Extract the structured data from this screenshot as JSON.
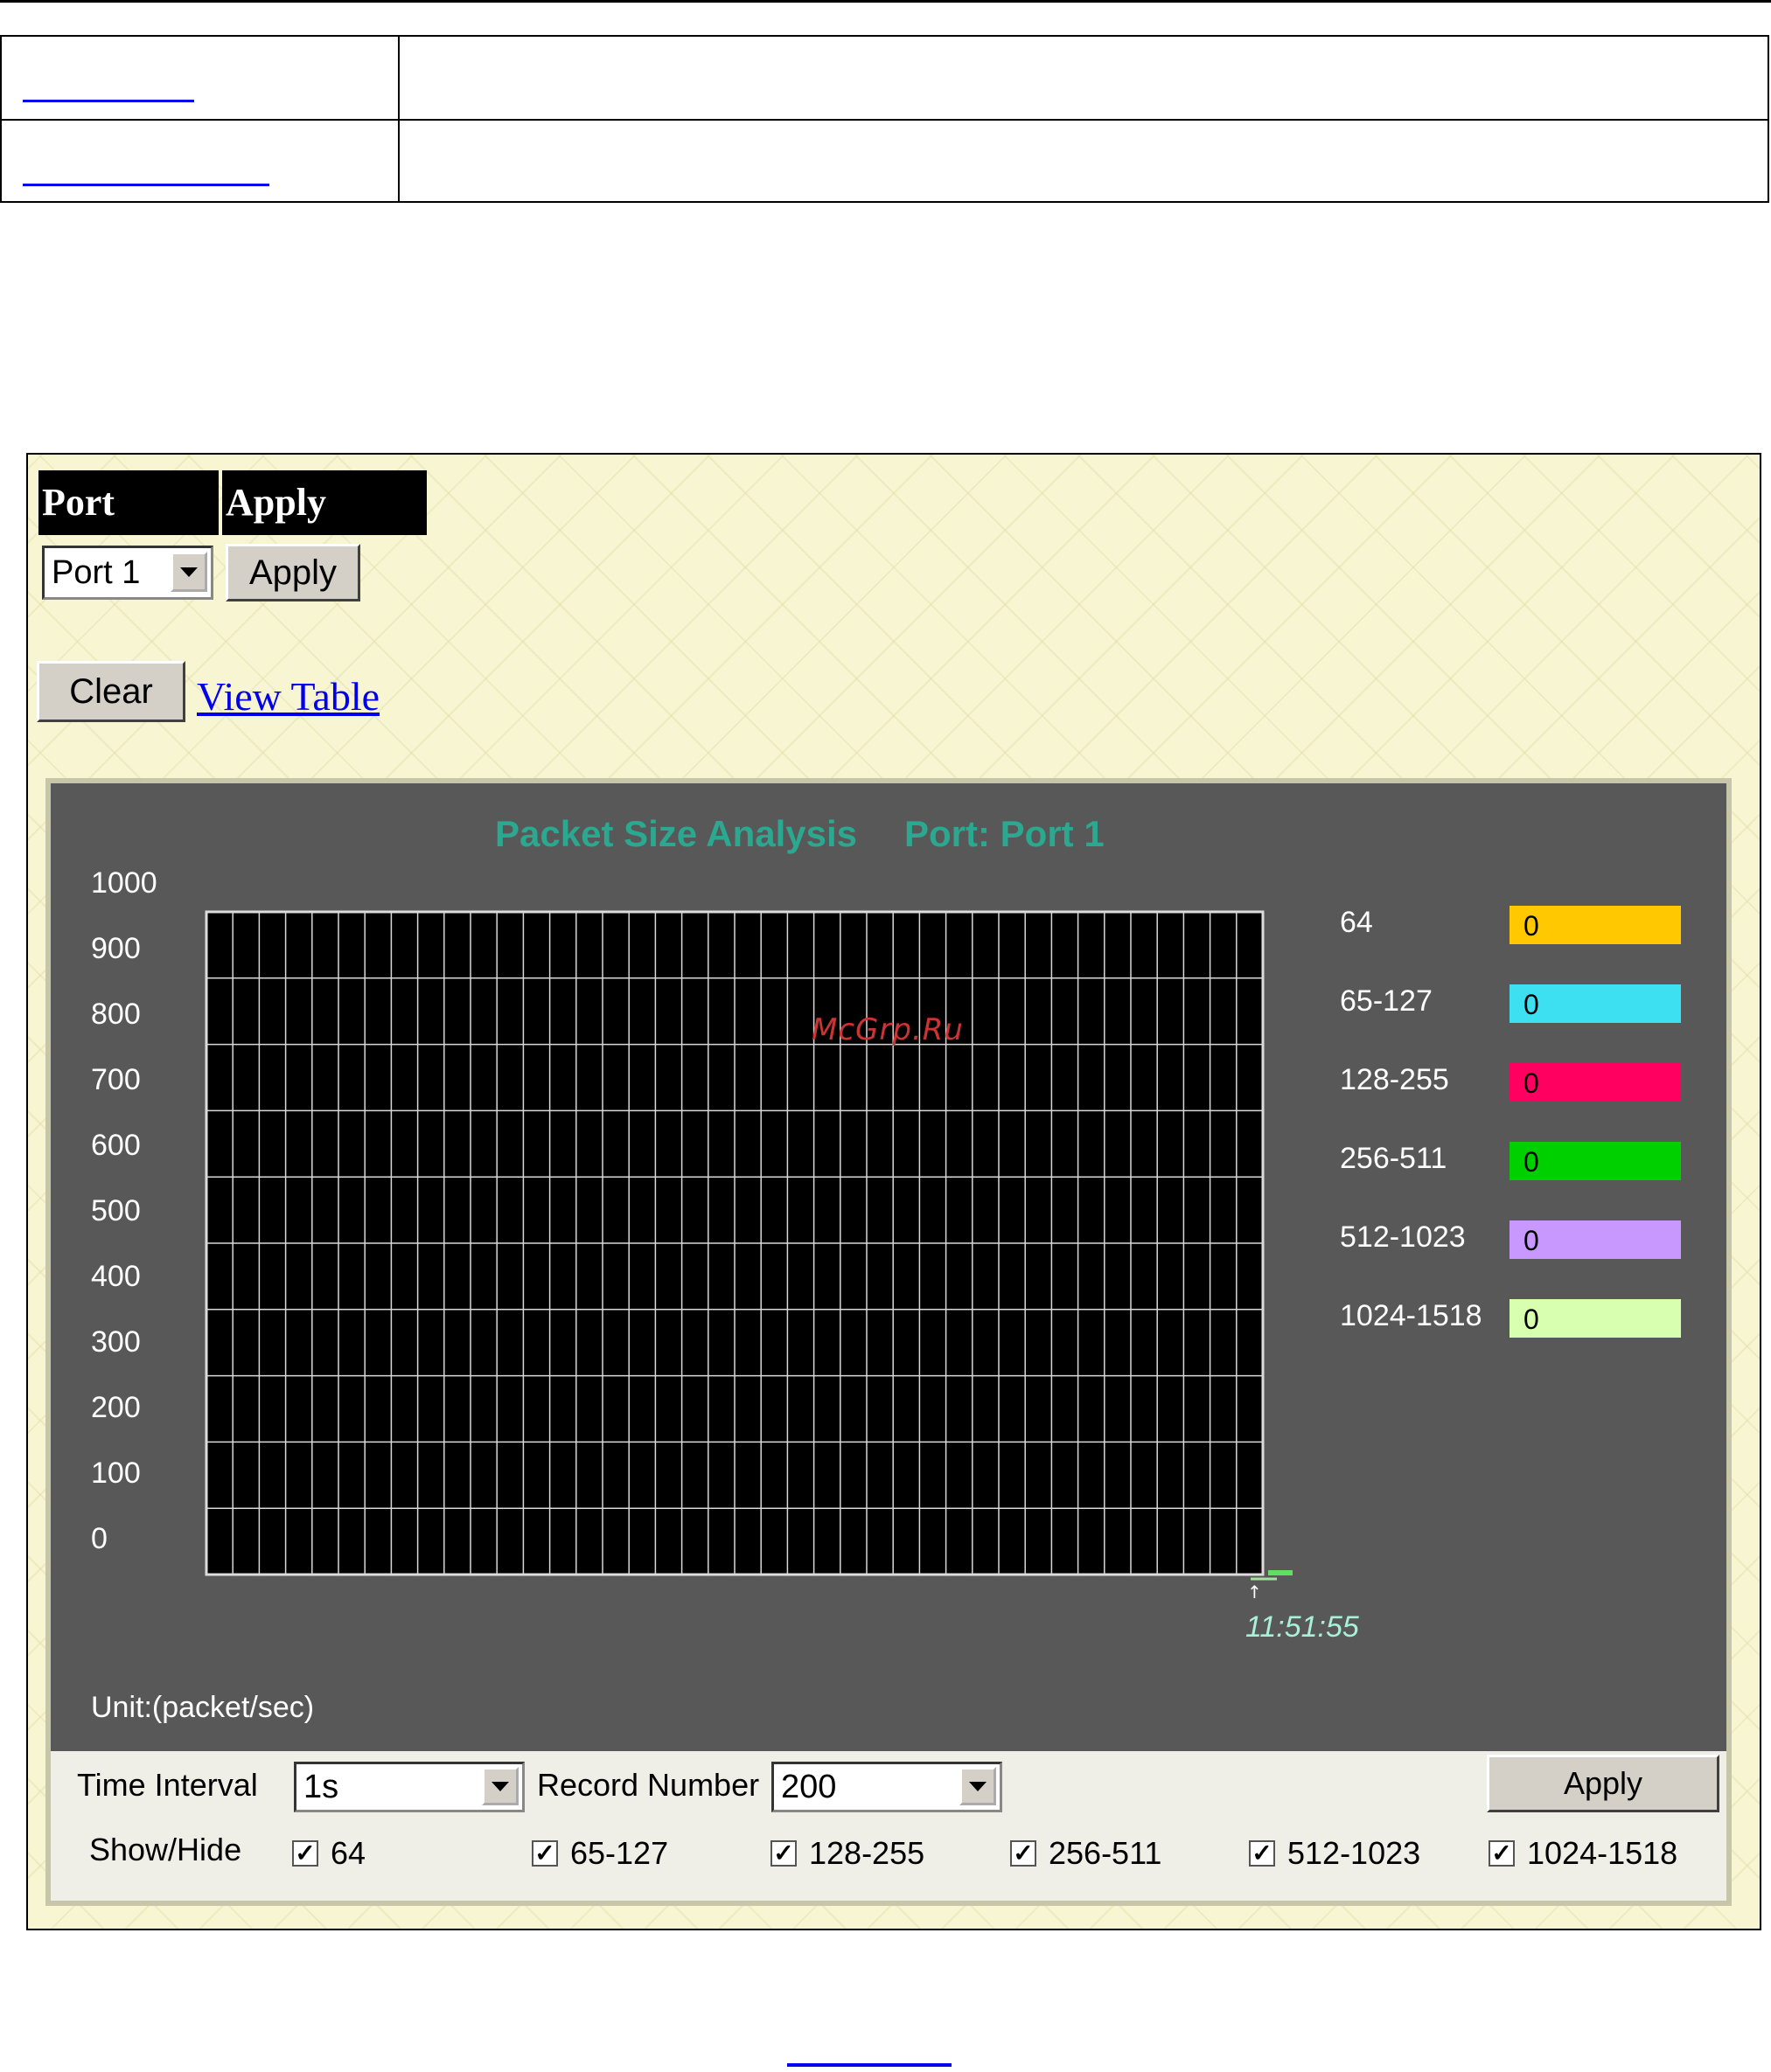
{
  "panel": {
    "header": {
      "port_label": "Port",
      "apply_label": "Apply"
    },
    "port_select": {
      "value": "Port 1"
    },
    "apply_button": "Apply",
    "clear_button": "Clear",
    "view_table_link": "View Table"
  },
  "chart_data": {
    "type": "line",
    "title": "Packet Size Analysis",
    "subtitle": "Port: Port 1",
    "ylim": [
      0,
      1000
    ],
    "yticks": [
      "1000",
      "900",
      "800",
      "700",
      "600",
      "500",
      "400",
      "300",
      "200",
      "100",
      "0"
    ],
    "x_tick_label": "11:51:55",
    "unit_label": "Unit:(packet/sec)",
    "grid": true,
    "legend_placement": "right",
    "series": [
      {
        "name": "64",
        "value": "0",
        "color": "#ffc800"
      },
      {
        "name": "65-127",
        "value": "0",
        "color": "#3ce0f0"
      },
      {
        "name": "128-255",
        "value": "0",
        "color": "#ff0060"
      },
      {
        "name": "256-511",
        "value": "0",
        "color": "#00d000"
      },
      {
        "name": "512-1023",
        "value": "0",
        "color": "#c898ff"
      },
      {
        "name": "1024-1518",
        "value": "0",
        "color": "#d8ffb0"
      }
    ]
  },
  "controls": {
    "time_interval_label": "Time Interval",
    "time_interval_value": "1s",
    "record_number_label": "Record Number",
    "record_number_value": "200",
    "apply_button": "Apply",
    "show_hide_label": "Show/Hide",
    "checkboxes": [
      "64",
      "65-127",
      "128-255",
      "256-511",
      "512-1023",
      "1024-1518"
    ]
  },
  "watermark": "McGrp.Ru"
}
